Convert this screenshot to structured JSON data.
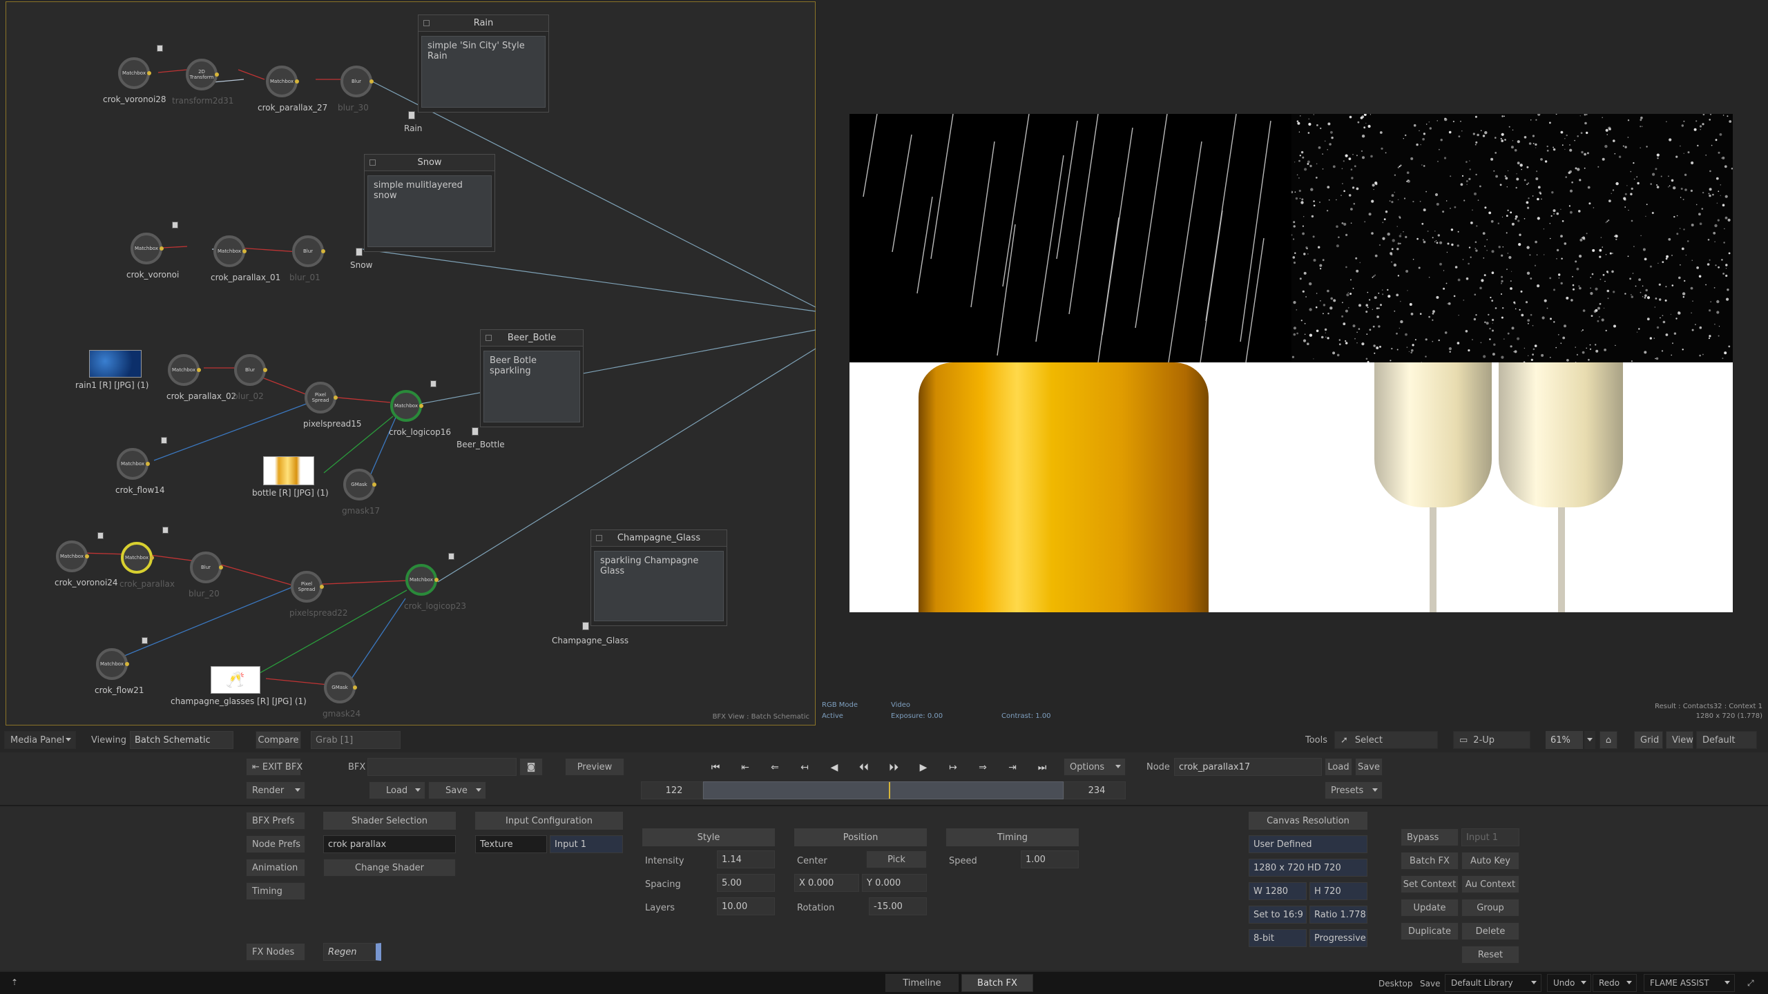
{
  "schematic": {
    "nodes": [
      {
        "label": "crok_voronoi28",
        "core": "Matchbox",
        "ring": "#5a5a5a",
        "dim": false
      },
      {
        "label": "transform2d31",
        "core": "2D Transform",
        "ring": "#5a5a5a",
        "dim": true
      },
      {
        "label": "crok_parallax_27",
        "core": "Matchbox",
        "ring": "#5a5a5a",
        "dim": false
      },
      {
        "label": "blur_30",
        "core": "Blur",
        "ring": "#5a5a5a",
        "dim": true
      },
      {
        "label": "crok_voronoi",
        "core": "Matchbox",
        "ring": "#5a5a5a",
        "dim": false
      },
      {
        "label": "crok_parallax_01",
        "core": "Matchbox",
        "ring": "#5a5a5a",
        "dim": false
      },
      {
        "label": "blur_01",
        "core": "Blur",
        "ring": "#5a5a5a",
        "dim": true
      },
      {
        "label": "crok_parallax_02",
        "core": "Matchbox",
        "ring": "#5a5a5a",
        "dim": false
      },
      {
        "label": "blur_02",
        "core": "Blur",
        "ring": "#5a5a5a",
        "dim": true
      },
      {
        "label": "pixelspread15",
        "core": "Pixel Spread",
        "ring": "#5a5a5a",
        "dim": false
      },
      {
        "label": "crok_logicop16",
        "core": "Matchbox",
        "ring": "#2a8a3a",
        "dim": false
      },
      {
        "label": "crok_flow14",
        "core": "Matchbox",
        "ring": "#5a5a5a",
        "dim": false
      },
      {
        "label": "gmask17",
        "core": "GMask",
        "ring": "#5a5a5a",
        "dim": true
      },
      {
        "label": "crok_voronoi24",
        "core": "Matchbox",
        "ring": "#5a5a5a",
        "dim": false
      },
      {
        "label": "crok_parallax",
        "core": "Matchbox",
        "ring": "#d8d030",
        "dim": true
      },
      {
        "label": "blur_20",
        "core": "Blur",
        "ring": "#5a5a5a",
        "dim": true
      },
      {
        "label": "pixelspread22",
        "core": "Pixel Spread",
        "ring": "#5a5a5a",
        "dim": true
      },
      {
        "label": "crok_logicop23",
        "core": "Matchbox",
        "ring": "#2a8a3a",
        "dim": true
      },
      {
        "label": "crok_flow21",
        "core": "Matchbox",
        "ring": "#5a5a5a",
        "dim": false
      },
      {
        "label": "gmask24",
        "core": "GMask",
        "ring": "#5a5a5a",
        "dim": true
      }
    ],
    "clips": [
      {
        "label": "rain1 [R] [JPG] (1)"
      },
      {
        "label": "bottle [R] [JPG] (1)"
      },
      {
        "label": "champagne_glasses [R] [JPG] (1)"
      }
    ],
    "outputs": [
      {
        "label": "Rain"
      },
      {
        "label": "Snow"
      },
      {
        "label": "Beer_Bottle"
      },
      {
        "label": "Champagne_Glass"
      }
    ],
    "notes": [
      {
        "title": "Rain",
        "text": "simple 'Sin City' Style Rain"
      },
      {
        "title": "Snow",
        "text": "simple mulitlayered snow"
      },
      {
        "title": "Beer_Botle",
        "text": "Beer Botle sparkling"
      },
      {
        "title": "Champagne_Glass",
        "text": "sparkling Champagne Glass"
      }
    ],
    "footer": "BFX View : Batch Schematic"
  },
  "viewer": {
    "rgb_mode": "RGB Mode",
    "active": "Active",
    "video": "Video",
    "exposure": "Exposure: 0.00",
    "contrast": "Contrast: 1.00",
    "result": "Result : Contacts32 : Context 1",
    "resolution": "1280 x 720 (1.778)"
  },
  "viewbar": {
    "media_panel": "Media Panel",
    "viewing": "Viewing",
    "viewing_value": "Batch Schematic",
    "compare": "Compare",
    "grab": "Grab [1]",
    "tools": "Tools",
    "select": "Select",
    "layout": "2-Up",
    "zoom": "61%",
    "grid": "Grid",
    "view": "View",
    "default": "Default"
  },
  "toolbar": {
    "exit_bfx": "EXIT BFX",
    "bfx": "BFX",
    "preview": "Preview",
    "render": "Render",
    "load": "Load",
    "save": "Save",
    "options": "Options",
    "node_label": "Node",
    "node_value": "crok_parallax17",
    "node_load": "Load",
    "node_save": "Save",
    "frame_start": "122",
    "frame_end": "234",
    "presets": "Presets"
  },
  "params": {
    "bfx_prefs": "BFX Prefs",
    "node_prefs": "Node Prefs",
    "animation": "Animation",
    "timing": "Timing",
    "fx_nodes": "FX Nodes",
    "regen": "Regen",
    "shader_selection": "Shader Selection",
    "shader_name": "crok parallax",
    "change_shader": "Change Shader",
    "input_configuration": "Input Configuration",
    "texture": "Texture",
    "input_1": "Input 1",
    "style": "Style",
    "intensity": "Intensity",
    "intensity_value": "1.14",
    "spacing": "Spacing",
    "spacing_value": "5.00",
    "layers": "Layers",
    "layers_value": "10.00",
    "position": "Position",
    "center": "Center",
    "pick": "Pick",
    "x_value": "X 0.000",
    "y_value": "Y 0.000",
    "rotation": "Rotation",
    "rotation_value": "-15.00",
    "timing_hdr": "Timing",
    "speed": "Speed",
    "speed_value": "1.00",
    "canvas_resolution": "Canvas Resolution",
    "user_defined": "User Defined",
    "res_preset": "1280 x 720 HD 720",
    "width": "W 1280",
    "height": "H 720",
    "set_to": "Set to 16:9",
    "ratio": "Ratio 1.778",
    "bit_depth": "8-bit",
    "scan": "Progressive",
    "bypass": "Bypass",
    "input1": "Input 1",
    "batch_fx": "Batch FX",
    "auto_key": "Auto Key",
    "set_context": "Set Context",
    "au_context": "Au Context",
    "update": "Update",
    "group": "Group",
    "duplicate": "Duplicate",
    "delete": "Delete",
    "reset": "Reset"
  },
  "bottom": {
    "timeline": "Timeline",
    "batch_fx": "Batch FX",
    "desktop": "Desktop",
    "save": "Save",
    "library": "Default Library",
    "undo": "Undo",
    "redo": "Redo",
    "app": "FLAME ASSIST"
  }
}
